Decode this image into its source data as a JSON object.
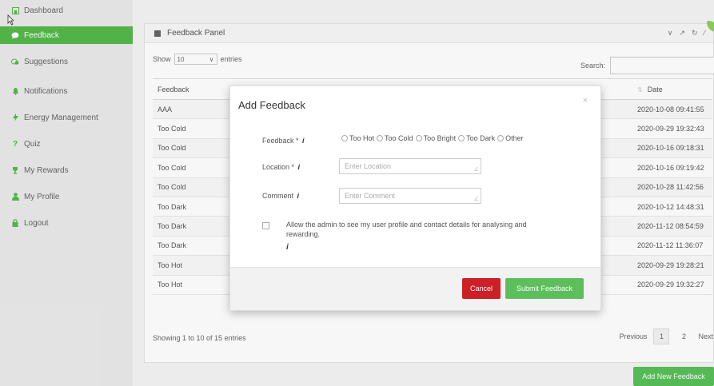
{
  "sidebar": {
    "items": [
      {
        "label": "Dashboard",
        "icon": "dashboard-icon"
      },
      {
        "label": "Feedback",
        "icon": "chat-bubble-icon",
        "active": true
      },
      {
        "label": "Suggestions",
        "icon": "suggestions-icon"
      },
      {
        "label": "Notifications",
        "icon": "bell-icon"
      },
      {
        "label": "Energy Management",
        "icon": "lightning-icon"
      },
      {
        "label": "Quiz",
        "icon": "question-icon"
      },
      {
        "label": "My Rewards",
        "icon": "trophy-icon"
      },
      {
        "label": "My Profile",
        "icon": "user-icon"
      },
      {
        "label": "Logout",
        "icon": "lock-icon"
      }
    ]
  },
  "panel": {
    "title": "Feedback Panel",
    "show_label": "Show",
    "show_value": "10",
    "entries_label": "entries",
    "search_label": "Search:",
    "columns": {
      "feedback": "Feedback",
      "date": "Date"
    },
    "rows": [
      {
        "feedback": "AAA",
        "date": "2020-10-08 09:41:55"
      },
      {
        "feedback": "Too Cold",
        "date": "2020-09-29 19:32:43"
      },
      {
        "feedback": "Too Cold",
        "date": "2020-10-16 09:18:31"
      },
      {
        "feedback": "Too Cold",
        "date": "2020-10-16 09:19:42"
      },
      {
        "feedback": "Too Cold",
        "date": "2020-10-28 11:42:56"
      },
      {
        "feedback": "Too Dark",
        "date": "2020-10-12 14:48:31"
      },
      {
        "feedback": "Too Dark",
        "date": "2020-11-12 08:54:59"
      },
      {
        "feedback": "Too Dark",
        "date": "2020-11-12 11:36:07"
      },
      {
        "feedback": "Too Hot",
        "date": "2020-09-29 19:28:21"
      },
      {
        "feedback": "Too Hot",
        "date": "2020-09-29 19:32:27"
      }
    ],
    "info": "Showing 1 to 10 of 15 entries",
    "pager": {
      "previous": "Previous",
      "page1": "1",
      "page2": "2",
      "next": "Next"
    },
    "add_button": "Add New Feedback"
  },
  "modal": {
    "title": "Add Feedback",
    "close": "×",
    "feedback_label": "Feedback * ",
    "info_glyph": "i",
    "options": [
      "Too Hot",
      "Too Cold",
      "Too Bright",
      "Too Dark",
      "Other"
    ],
    "location_label": "Location * ",
    "location_placeholder": "Enter Location",
    "comment_label": "Comment ",
    "comment_placeholder": "Enter Comment",
    "consent_text": "Allow the admin to see my user profile and contact details for analysing and rewarding.",
    "cancel": "Cancel",
    "submit": "Submit Feedback"
  },
  "colors": {
    "accent": "#53b84a",
    "danger": "#cd1f26"
  }
}
